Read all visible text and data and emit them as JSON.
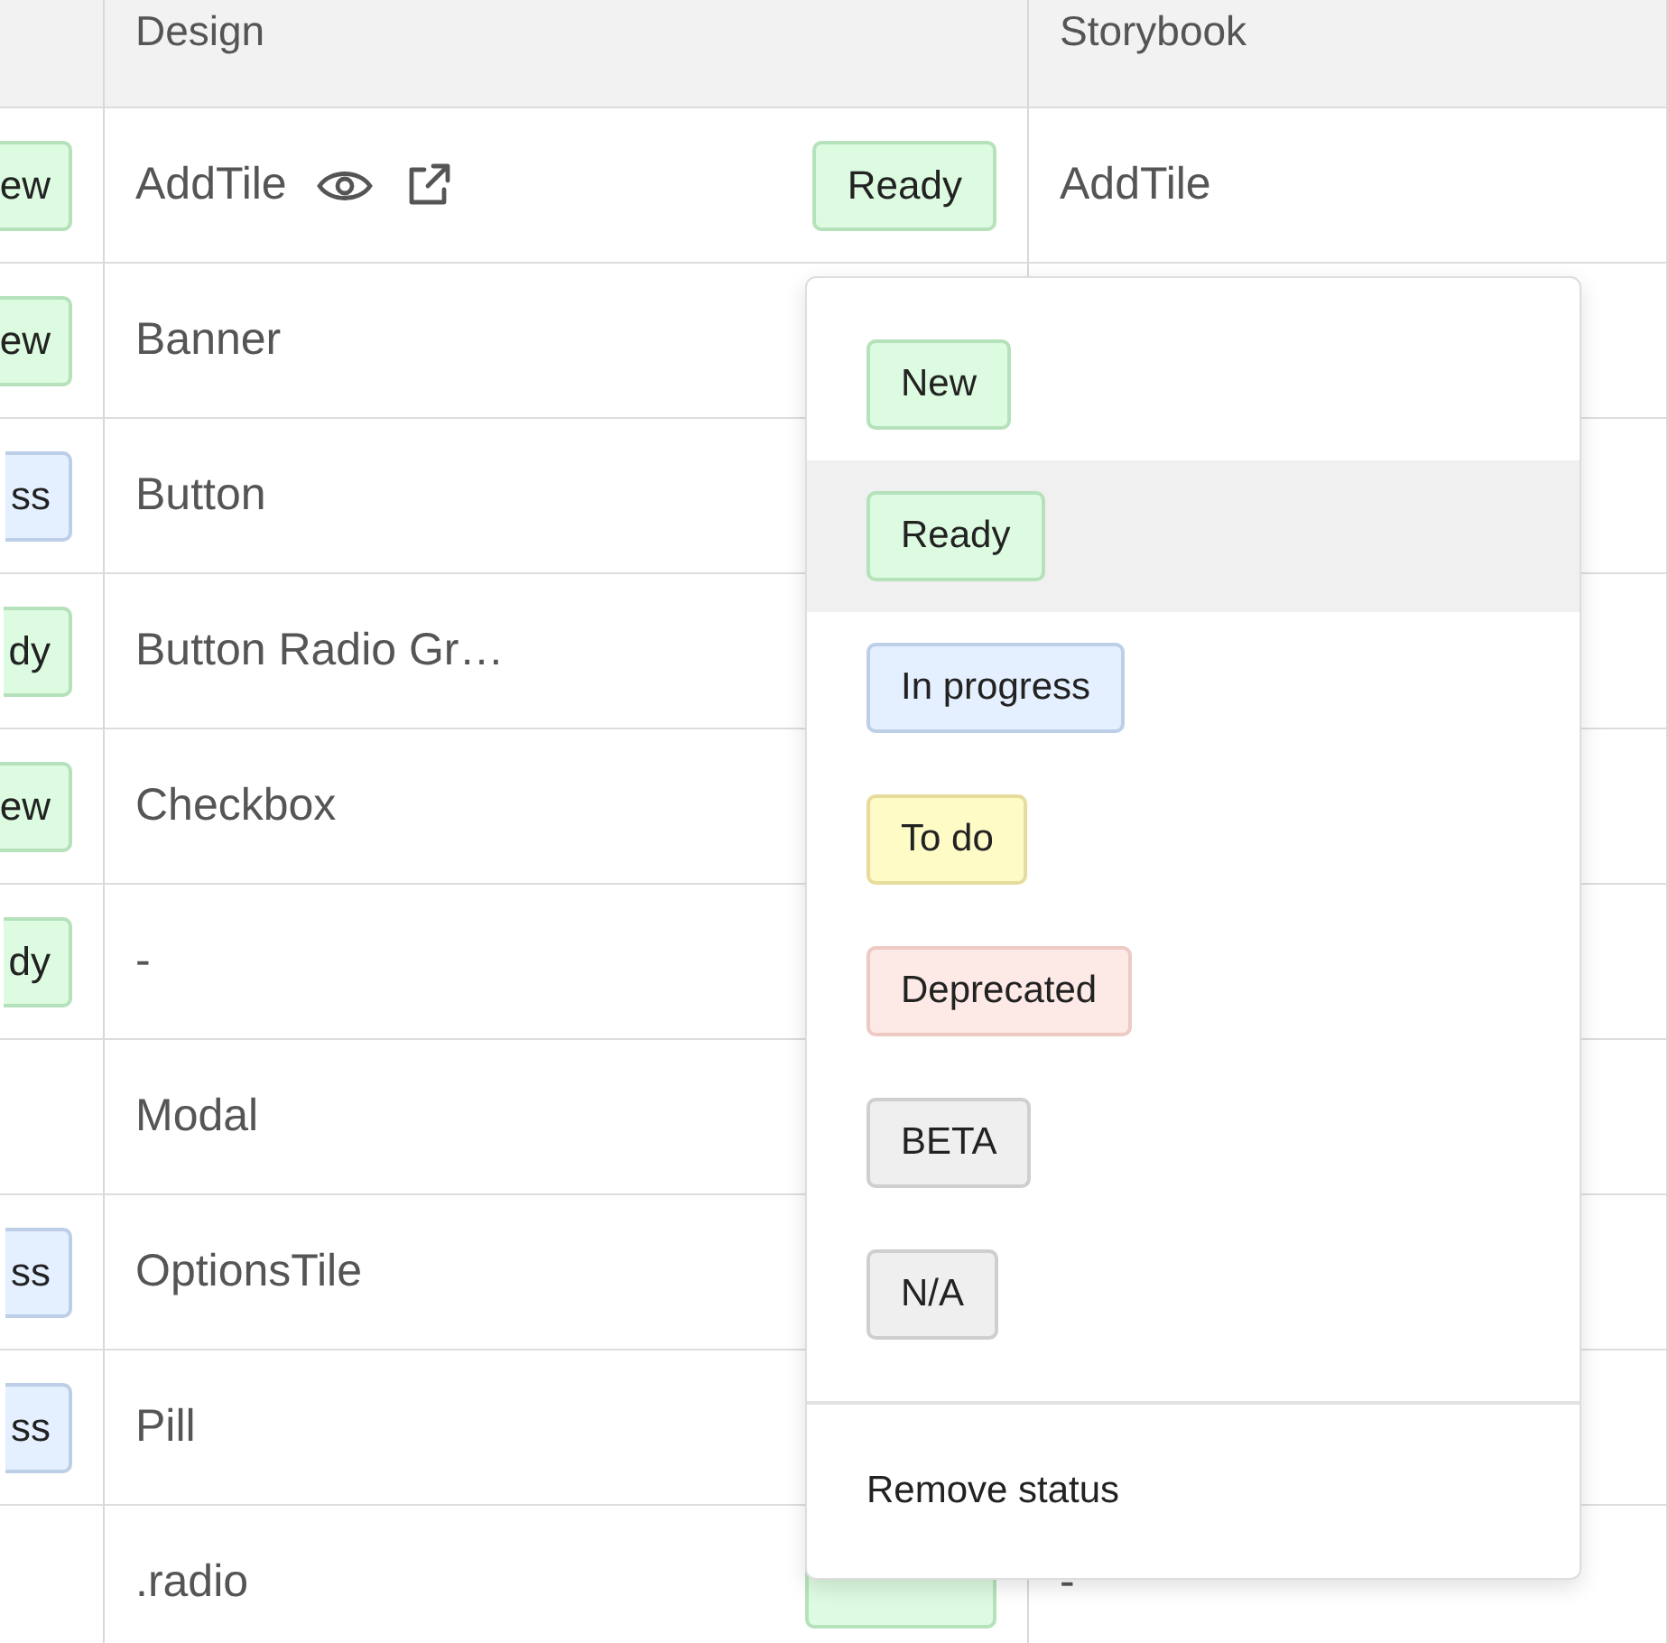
{
  "table": {
    "columns": [
      "Design",
      "Storybook"
    ],
    "rows": [
      {
        "status": {
          "text": "ew",
          "kind": "green"
        },
        "design": "AddTile",
        "links": true,
        "design_status": {
          "text": "Ready",
          "kind": "green"
        },
        "storybook": "AddTile"
      },
      {
        "status": {
          "text": "ew",
          "kind": "green"
        },
        "design": "Banner"
      },
      {
        "status": {
          "text": "ss",
          "kind": "blue"
        },
        "design": "Button"
      },
      {
        "status": {
          "text": "dy",
          "kind": "green"
        },
        "design": "Button Radio Gr…"
      },
      {
        "status": {
          "text": "ew",
          "kind": "green"
        },
        "design": "Checkbox"
      },
      {
        "status": {
          "text": "dy",
          "kind": "green"
        },
        "design": "-"
      },
      {
        "design": "Modal"
      },
      {
        "status": {
          "text": "ss",
          "kind": "blue"
        },
        "design": "OptionsTile"
      },
      {
        "status": {
          "text": "ss",
          "kind": "blue"
        },
        "design": "Pill"
      },
      {
        "design": ".radio",
        "design_status": {
          "kind": "green"
        },
        "storybook": "-"
      }
    ]
  },
  "status_menu": {
    "options": [
      {
        "text": "New",
        "kind": "green",
        "selected": false
      },
      {
        "text": "Ready",
        "kind": "green",
        "selected": true
      },
      {
        "text": "In progress",
        "kind": "blue",
        "selected": false
      },
      {
        "text": "To do",
        "kind": "yellow",
        "selected": false
      },
      {
        "text": "Deprecated",
        "kind": "red",
        "selected": false
      },
      {
        "text": "BETA",
        "kind": "gray",
        "selected": false
      },
      {
        "text": "N/A",
        "kind": "gray",
        "selected": false
      }
    ],
    "remove": "Remove status"
  }
}
